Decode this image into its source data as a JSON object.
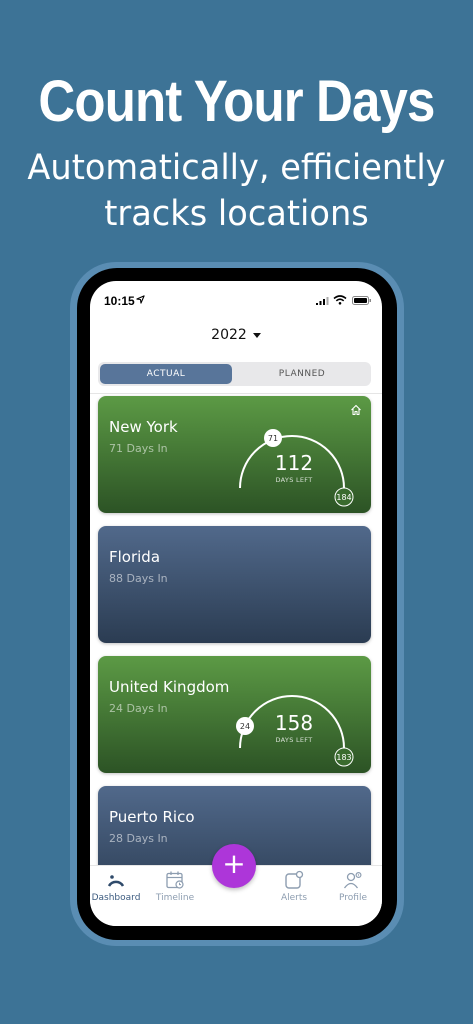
{
  "headline": "Count Your Days",
  "subheadline_line1": "Automatically, efficiently",
  "subheadline_line2": "tracks locations",
  "status_bar": {
    "time": "10:15"
  },
  "year_selector": {
    "value": "2022"
  },
  "segments": {
    "actual": "ACTUAL",
    "planned": "PLANNED",
    "selected": "ACTUAL"
  },
  "cards": [
    {
      "name": "New York",
      "days_in": "71 Days In",
      "gauge": {
        "start": "71",
        "center": "112",
        "center_label": "DAYS LEFT",
        "end": "184",
        "progress": 0.39
      },
      "home_icon": true,
      "color": "#5c9a45"
    },
    {
      "name": "Florida",
      "days_in": "88 Days In",
      "color": "#51698b"
    },
    {
      "name": "United Kingdom",
      "days_in": "24 Days In",
      "gauge": {
        "start": "24",
        "center": "158",
        "center_label": "DAYS LEFT",
        "end": "183",
        "progress": 0.13
      },
      "color": "#5c9a45"
    },
    {
      "name": "Puerto Rico",
      "days_in": "28 Days In",
      "color": "#51698b"
    }
  ],
  "tabbar": {
    "items": [
      {
        "label": "Dashboard",
        "icon": "dashboard-icon",
        "active": true
      },
      {
        "label": "Timeline",
        "icon": "calendar-icon",
        "active": false
      },
      {
        "label": "Alerts",
        "icon": "alert-icon",
        "active": false
      },
      {
        "label": "Profile",
        "icon": "profile-icon",
        "active": false
      }
    ],
    "fab_label": "+"
  },
  "colors": {
    "background": "#3d7396",
    "accent_fab": "#ad36d9",
    "segment_active": "#58759a"
  }
}
